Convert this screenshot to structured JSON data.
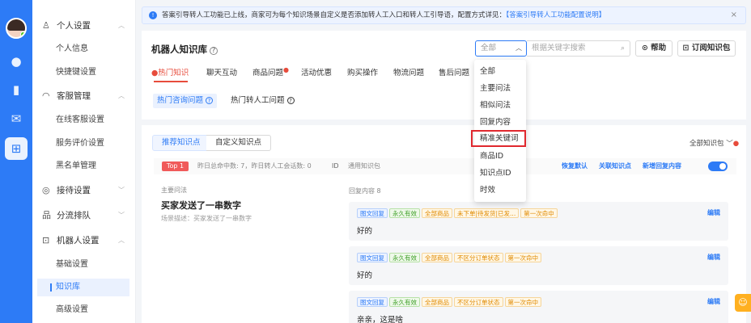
{
  "rail": {
    "icons": [
      "chat-icon",
      "chart-icon",
      "mail-icon",
      "apps-icon"
    ]
  },
  "sidebar": {
    "groups": [
      {
        "label": "个人设置",
        "icon": "user-icon",
        "items": [
          "个人信息",
          "快捷键设置"
        ]
      },
      {
        "label": "客服管理",
        "icon": "headset-icon",
        "items": [
          "在线客服设置",
          "服务评价设置",
          "黑名单管理"
        ]
      },
      {
        "label": "接待设置",
        "icon": "compass-icon",
        "items": []
      },
      {
        "label": "分流排队",
        "icon": "flow-icon",
        "items": []
      },
      {
        "label": "机器人设置",
        "icon": "robot-icon",
        "items": [
          "基础设置",
          "知识库",
          "高级设置"
        ]
      }
    ],
    "active_item": "知识库"
  },
  "notice": {
    "text": "答案引导转人工功能已上线，商家可为每个知识场景自定义是否添加转人工入口和转人工引导语，配置方式详见：",
    "link": "【答案引导转人工功能配置说明】",
    "close": "×"
  },
  "header": {
    "title": "机器人知识库",
    "select_value": "全部",
    "search_placeholder": "根据关键字搜索",
    "help_label": "帮助",
    "subscribe_label": "订阅知识包"
  },
  "tabs": [
    "热门知识",
    "聊天互动",
    "商品问题",
    "活动优惠",
    "购买操作",
    "物流问题",
    "售后问题"
  ],
  "subtabs": [
    "热门咨询问题",
    "热门转人工问题"
  ],
  "content": {
    "tab_recommend": "推荐知识点",
    "tab_custom": "自定义知识点",
    "all_kb": "全部知识包",
    "top_badge": "Top 1",
    "stat_text": "昨日总命中数: 7，昨日转人工会话数: 0",
    "id_label": "ID",
    "kb_name": "通用知识包",
    "action_restore": "恢复默认",
    "action_link": "关联知识点",
    "action_add": "新增回复内容",
    "main_question_label": "主要问法",
    "main_question": "买家发送了一串数字",
    "scene_desc": "场景描述：买家发送了一串数字",
    "reply_label": "回复内容 8",
    "edit_label": "编辑",
    "replies": [
      {
        "tags": [
          "图文回复",
          "永久有效",
          "全部商品",
          "未下单|待发货|已发...",
          "第一次命中"
        ],
        "text": "好的"
      },
      {
        "tags": [
          "图文回复",
          "永久有效",
          "全部商品",
          "不区分订单状态",
          "第一次命中"
        ],
        "text": "好的"
      },
      {
        "tags": [
          "图文回复",
          "永久有效",
          "全部商品",
          "不区分订单状态",
          "第一次命中"
        ],
        "text": "亲亲，这是啥"
      }
    ]
  },
  "dropdown": {
    "options": [
      "全部",
      "主要问法",
      "相似问法",
      "回复内容",
      "精准关键词",
      "商品ID",
      "知识点ID",
      "时效"
    ],
    "highlighted": "精准关键词"
  },
  "colors": {
    "primary": "#2d7bf6",
    "accent_red": "#e74c3c",
    "highlight_border": "#e0282e"
  }
}
